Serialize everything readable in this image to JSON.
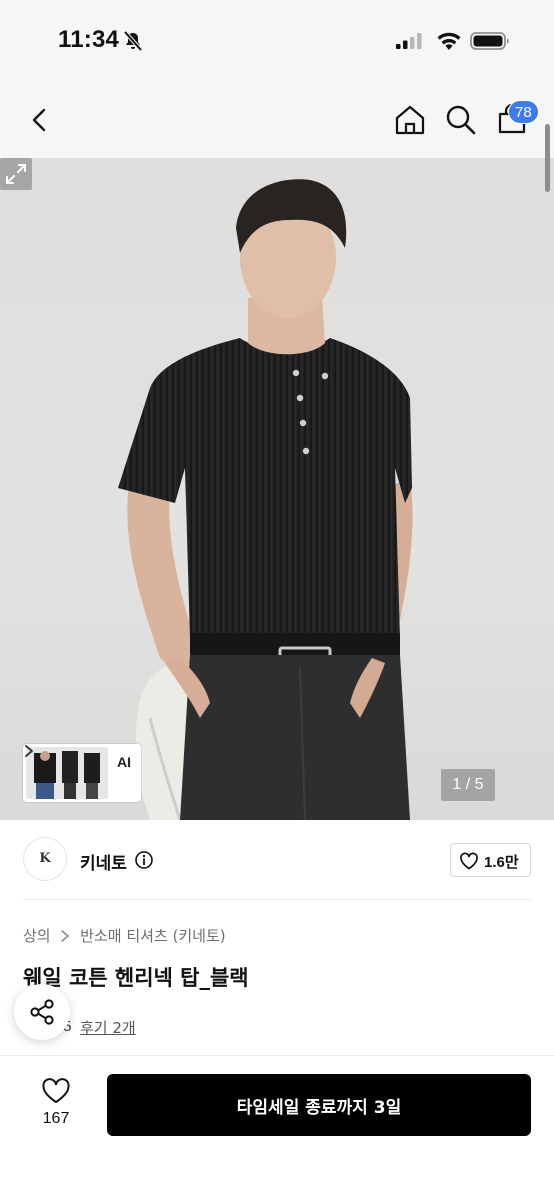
{
  "status_bar": {
    "time": "11:34"
  },
  "nav": {
    "cart_badge": "78",
    "icons": [
      "back-icon",
      "home-icon",
      "search-icon",
      "cart-icon"
    ]
  },
  "gallery": {
    "ai_label": "AI",
    "page_counter": "1 / 5",
    "slide_index": 1,
    "slide_total": 5
  },
  "brand": {
    "logo_text": "K",
    "name": "키네토",
    "like_count": "1.6만"
  },
  "breadcrumb": [
    "상의",
    "반소매 티셔츠 (키네토)"
  ],
  "product": {
    "title": "웨일 코튼 헨리넥 탑_블랙",
    "rating_score": ".5",
    "review_link": "후기 2개"
  },
  "bottom_bar": {
    "wish_count": "167",
    "buy_label": "타임세일 종료까지 3일"
  },
  "colors": {
    "badge": "#3d7bf2",
    "buy_button": "#000000",
    "rating_star": "#f5a623"
  }
}
